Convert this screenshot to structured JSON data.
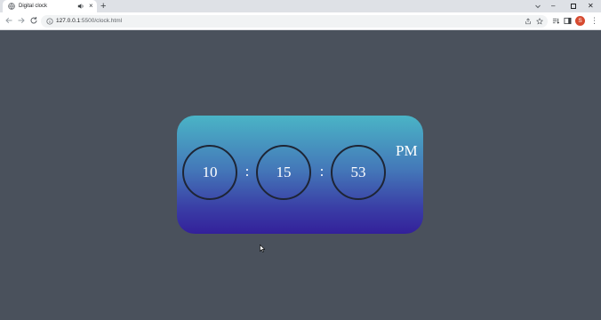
{
  "browser": {
    "tab": {
      "title": "Digital clock",
      "close_label": "×"
    },
    "new_tab_label": "+",
    "window_controls": {
      "minimize": "–",
      "close": "✕"
    },
    "url": {
      "host": "127.0.0.1",
      "rest": ":5500/clock.html"
    },
    "profile_initial": "S",
    "menu_label": "⋮",
    "icons": {
      "favicon": "globe-icon",
      "audio": "speaker-icon",
      "back": "back-arrow-icon",
      "forward": "forward-arrow-icon",
      "reload": "reload-icon",
      "site_info": "info-icon",
      "share": "share-icon",
      "bookmark": "star-icon",
      "reading_list": "reading-list-icon",
      "side_panel": "side-panel-icon",
      "tab_search": "chevron-down-icon"
    },
    "colors": {
      "profile": "#d64a30"
    }
  },
  "clock": {
    "hours": "10",
    "minutes": "15",
    "seconds": "53",
    "separator": ":",
    "period": "PM",
    "colors": {
      "gradient_top": "#4ab4c6",
      "gradient_bottom": "#33209a",
      "page_background": "#4a515c"
    }
  }
}
